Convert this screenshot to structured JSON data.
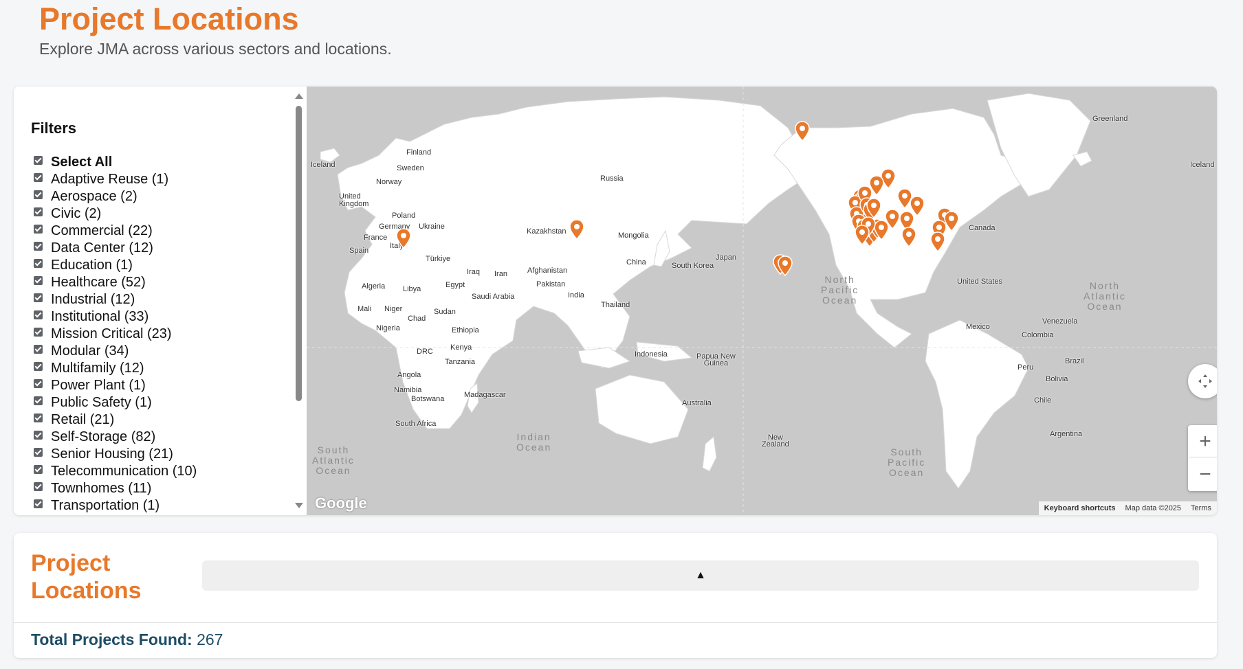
{
  "header": {
    "title": "Project Locations",
    "subtitle": "Explore JMA across various sectors and locations."
  },
  "filters": {
    "title": "Filters",
    "items": [
      {
        "label": "Select All",
        "checked": true
      },
      {
        "label": "Adaptive Reuse (1)",
        "checked": true
      },
      {
        "label": "Aerospace (2)",
        "checked": true
      },
      {
        "label": "Civic (2)",
        "checked": true
      },
      {
        "label": "Commercial (22)",
        "checked": true
      },
      {
        "label": "Data Center (12)",
        "checked": true
      },
      {
        "label": "Education (1)",
        "checked": true
      },
      {
        "label": "Healthcare (52)",
        "checked": true
      },
      {
        "label": "Industrial (12)",
        "checked": true
      },
      {
        "label": "Institutional (33)",
        "checked": true
      },
      {
        "label": "Mission Critical (23)",
        "checked": true
      },
      {
        "label": "Modular (34)",
        "checked": true
      },
      {
        "label": "Multifamily (12)",
        "checked": true
      },
      {
        "label": "Power Plant (1)",
        "checked": true
      },
      {
        "label": "Public Safety (1)",
        "checked": true
      },
      {
        "label": "Retail (21)",
        "checked": true
      },
      {
        "label": "Self-Storage (82)",
        "checked": true
      },
      {
        "label": "Senior Housing (21)",
        "checked": true
      },
      {
        "label": "Telecommunication (10)",
        "checked": true
      },
      {
        "label": "Townhomes (11)",
        "checked": true
      },
      {
        "label": "Transportation (1)",
        "checked": true
      }
    ]
  },
  "map": {
    "labels": {
      "iceland_w": "Iceland",
      "finland": "Finland",
      "sweden": "Sweden",
      "norway": "Norway",
      "uk": "United\nKingdom",
      "poland": "Poland",
      "germany": "Germany",
      "ukraine": "Ukraine",
      "france": "France",
      "spain": "Spain",
      "italy": "Italy",
      "turkiye": "Türkiye",
      "russia": "Russia",
      "kazakhstan": "Kazakhstan",
      "mongolia": "Mongolia",
      "china": "China",
      "japan": "Japan",
      "south_korea": "South Korea",
      "iraq": "Iraq",
      "iran": "Iran",
      "afghanistan": "Afghanistan",
      "pakistan": "Pakistan",
      "india": "India",
      "saudi": "Saudi Arabia",
      "egypt": "Egypt",
      "libya": "Libya",
      "algeria": "Algeria",
      "mali": "Mali",
      "niger": "Niger",
      "chad": "Chad",
      "sudan": "Sudan",
      "nigeria": "Nigeria",
      "ethiopia": "Ethiopia",
      "kenya": "Kenya",
      "drc": "DRC",
      "tanzania": "Tanzania",
      "angola": "Angola",
      "namibia": "Namibia",
      "botswana": "Botswana",
      "madagascar": "Madagascar",
      "south_africa": "South Africa",
      "thailand": "Thailand",
      "indonesia": "Indonesia",
      "png": "Papua New\nGuinea",
      "australia": "Australia",
      "new_zealand": "New\nZealand",
      "canada": "Canada",
      "united_states": "United States",
      "mexico": "Mexico",
      "venezuela": "Venezuela",
      "colombia": "Colombia",
      "peru": "Peru",
      "brazil": "Brazil",
      "bolivia": "Bolivia",
      "chile": "Chile",
      "argentina": "Argentina",
      "greenland": "Greenland",
      "iceland_e": "Iceland"
    },
    "oceans": {
      "south_atlantic": "South\nAtlantic\nOcean",
      "indian": "Indian\nOcean",
      "north_pacific": "North\nPacific\nOcean",
      "south_pacific": "South\nPacific\nOcean",
      "north_atlantic": "North\nAtlantic\nOcean"
    },
    "google_logo": "Google",
    "attribution": {
      "keyboard": "Keyboard shortcuts",
      "map_data": "Map data ©2025",
      "terms": "Terms"
    },
    "marker_color": "#e8782a",
    "controls": {
      "zoom_in": "+",
      "zoom_out": "−",
      "camera_icon": "camera-control-icon"
    }
  },
  "project_list": {
    "title": "Project Locations",
    "toggle_symbol": "▲",
    "total_label": "Total Projects Found:",
    "total_value": "267"
  }
}
